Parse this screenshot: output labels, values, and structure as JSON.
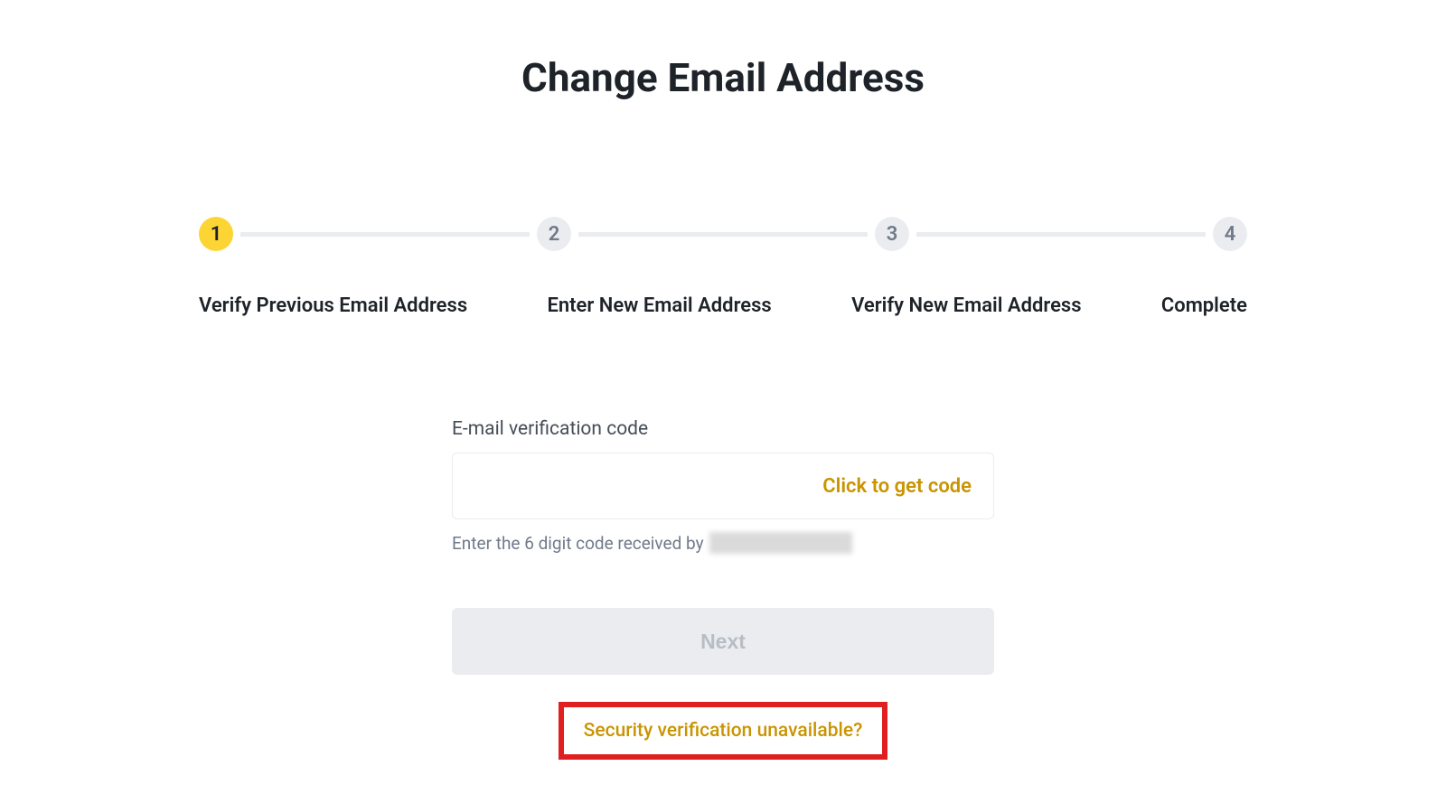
{
  "page": {
    "title": "Change Email Address"
  },
  "stepper": {
    "steps": [
      {
        "number": "1",
        "label": "Verify Previous Email Address",
        "active": true
      },
      {
        "number": "2",
        "label": "Enter New Email Address",
        "active": false
      },
      {
        "number": "3",
        "label": "Verify New Email Address",
        "active": false
      },
      {
        "number": "4",
        "label": "Complete",
        "active": false
      }
    ]
  },
  "form": {
    "field_label": "E-mail verification code",
    "get_code_label": "Click to get code",
    "helper_text": "Enter the 6 digit code received by",
    "next_button_label": "Next",
    "security_link_label": "Security verification unavailable?"
  },
  "colors": {
    "accent_yellow": "#fcd535",
    "accent_gold": "#c99400",
    "inactive_bg": "#eaecef",
    "highlight_red": "#e02020"
  }
}
